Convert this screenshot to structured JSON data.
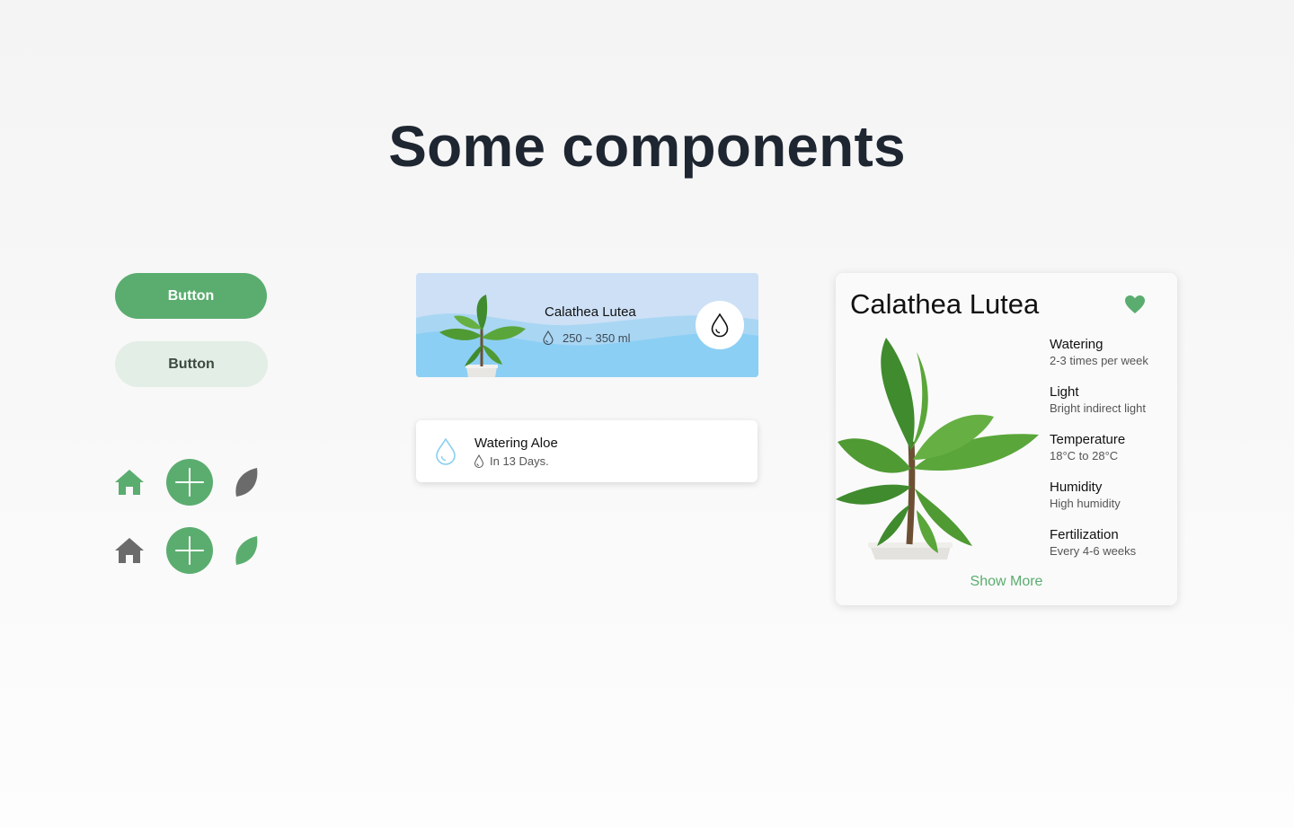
{
  "page": {
    "title": "Some components"
  },
  "buttons": {
    "primary_label": "Button",
    "secondary_label": "Button"
  },
  "icons": {
    "row1": [
      "home-icon",
      "add-icon",
      "leaf-icon"
    ],
    "row2": [
      "home-icon",
      "add-icon",
      "leaf-icon"
    ]
  },
  "watering_card": {
    "plant_name": "Calathea Lutea",
    "amount": "250 ~ 350 ml"
  },
  "notification": {
    "title": "Watering Aloe",
    "subtitle": "In 13 Days."
  },
  "detail_card": {
    "title": "Calathea Lutea",
    "specs": [
      {
        "label": "Watering",
        "value": "2-3 times per week"
      },
      {
        "label": "Light",
        "value": "Bright indirect light"
      },
      {
        "label": "Temperature",
        "value": "18°C to 28°C"
      },
      {
        "label": "Humidity",
        "value": "High humidity"
      },
      {
        "label": "Fertilization",
        "value": "Every 4-6 weeks"
      }
    ],
    "show_more": "Show More"
  },
  "colors": {
    "accent_green": "#5bad6f",
    "secondary_button_bg": "#e3eee6",
    "title_text": "#1e2631",
    "sky_light": "#cde0f6",
    "water_blue": "#89cff0",
    "icon_gray": "#6b6b6b"
  }
}
